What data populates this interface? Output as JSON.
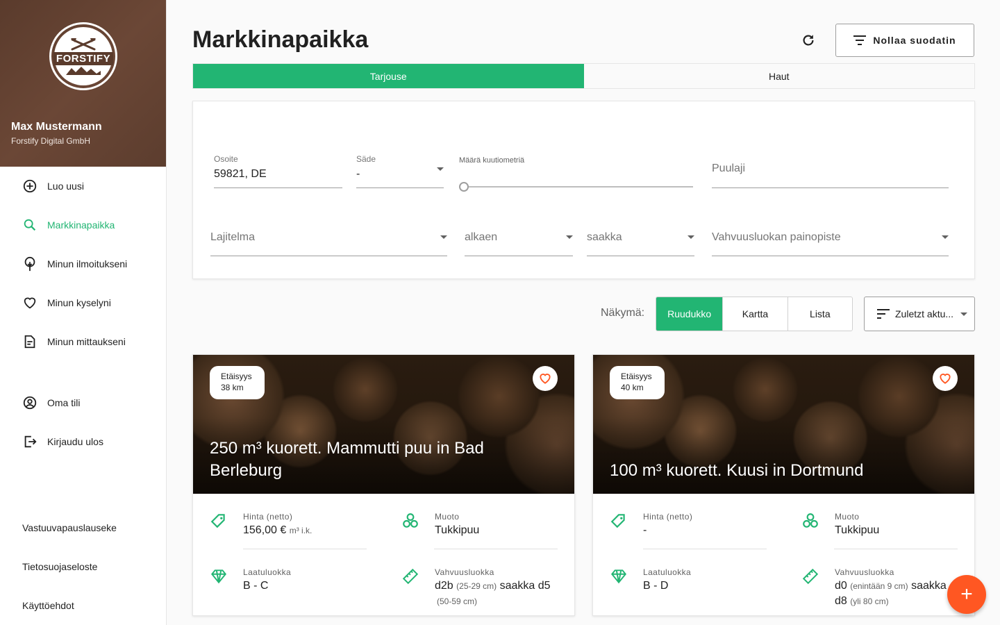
{
  "brand": {
    "logo_text": "FORSTIFY",
    "accent": "#22b573",
    "header_color": "#5a3b2c",
    "fab_color": "#ff5722"
  },
  "user": {
    "name": "Max Mustermann",
    "company": "Forstify Digital GmbH"
  },
  "sidebar": {
    "items": [
      {
        "label": "Luo uusi",
        "icon": "plus-circle-icon"
      },
      {
        "label": "Markkinapaikka",
        "icon": "search-icon",
        "active": true
      },
      {
        "label": "Minun ilmoitukseni",
        "icon": "tree-icon"
      },
      {
        "label": "Minun kyselyni",
        "icon": "heart-icon"
      },
      {
        "label": "Minun mittaukseni",
        "icon": "document-icon"
      },
      {
        "label": "Oma tili",
        "icon": "account-icon"
      },
      {
        "label": "Kirjaudu ulos",
        "icon": "logout-icon"
      }
    ],
    "footer": [
      "Vastuuvapauslauseke",
      "Tietosuojaseloste",
      "Käyttöehdot"
    ]
  },
  "header": {
    "title": "Markkinapaikka",
    "reset_label": "Nollaa suodatin"
  },
  "tabs": [
    {
      "label": "Tarjouse",
      "active": true
    },
    {
      "label": "Haut",
      "active": false
    }
  ],
  "filters": {
    "address": {
      "label": "Osoite",
      "value": "59821, DE"
    },
    "radius": {
      "label": "Säde",
      "value": "-"
    },
    "volume": {
      "label": "Määrä kuutiometriä",
      "level": 0
    },
    "species": {
      "placeholder": "Puulaji"
    },
    "assortment": {
      "placeholder": "Lajitelma"
    },
    "from": {
      "placeholder": "alkaen"
    },
    "to": {
      "placeholder": "saakka"
    },
    "strength_focus": {
      "placeholder": "Vahvuusluokan painopiste"
    }
  },
  "view": {
    "label": "Näkymä:",
    "options": [
      {
        "label": "Ruudukko",
        "active": true
      },
      {
        "label": "Kartta"
      },
      {
        "label": "Lista"
      }
    ],
    "sort_label": "Zuletzt aktu..."
  },
  "cards": [
    {
      "distance_label": "Etäisyys",
      "distance_value": "38 km",
      "title": "250 m³ kuorett. Mammutti puu in Bad Berleburg",
      "price_label": "Hinta (netto)",
      "price_value": "156,00 €",
      "price_unit": "m³ i.k.",
      "form_label": "Muoto",
      "form_value": "Tukkipuu",
      "quality_label": "Laatuluokka",
      "quality_value": "B - C",
      "strength_label": "Vahvuusluokka",
      "strength_from": "d2b",
      "strength_from_note": "(25-29 cm)",
      "strength_sep": "saakka",
      "strength_to": "d5",
      "strength_to_note": "(50-59 cm)"
    },
    {
      "distance_label": "Etäisyys",
      "distance_value": "40 km",
      "title": "100 m³ kuorett. Kuusi in Dortmund",
      "price_label": "Hinta (netto)",
      "price_value": "-",
      "price_unit": "",
      "form_label": "Muoto",
      "form_value": "Tukkipuu",
      "quality_label": "Laatuluokka",
      "quality_value": "B - D",
      "strength_label": "Vahvuusluokka",
      "strength_from": "d0",
      "strength_from_note": "(enintään 9 cm)",
      "strength_sep": "saakka",
      "strength_to": "d8",
      "strength_to_note": "(yli 80 cm)"
    }
  ],
  "fab": {
    "label": "+"
  }
}
